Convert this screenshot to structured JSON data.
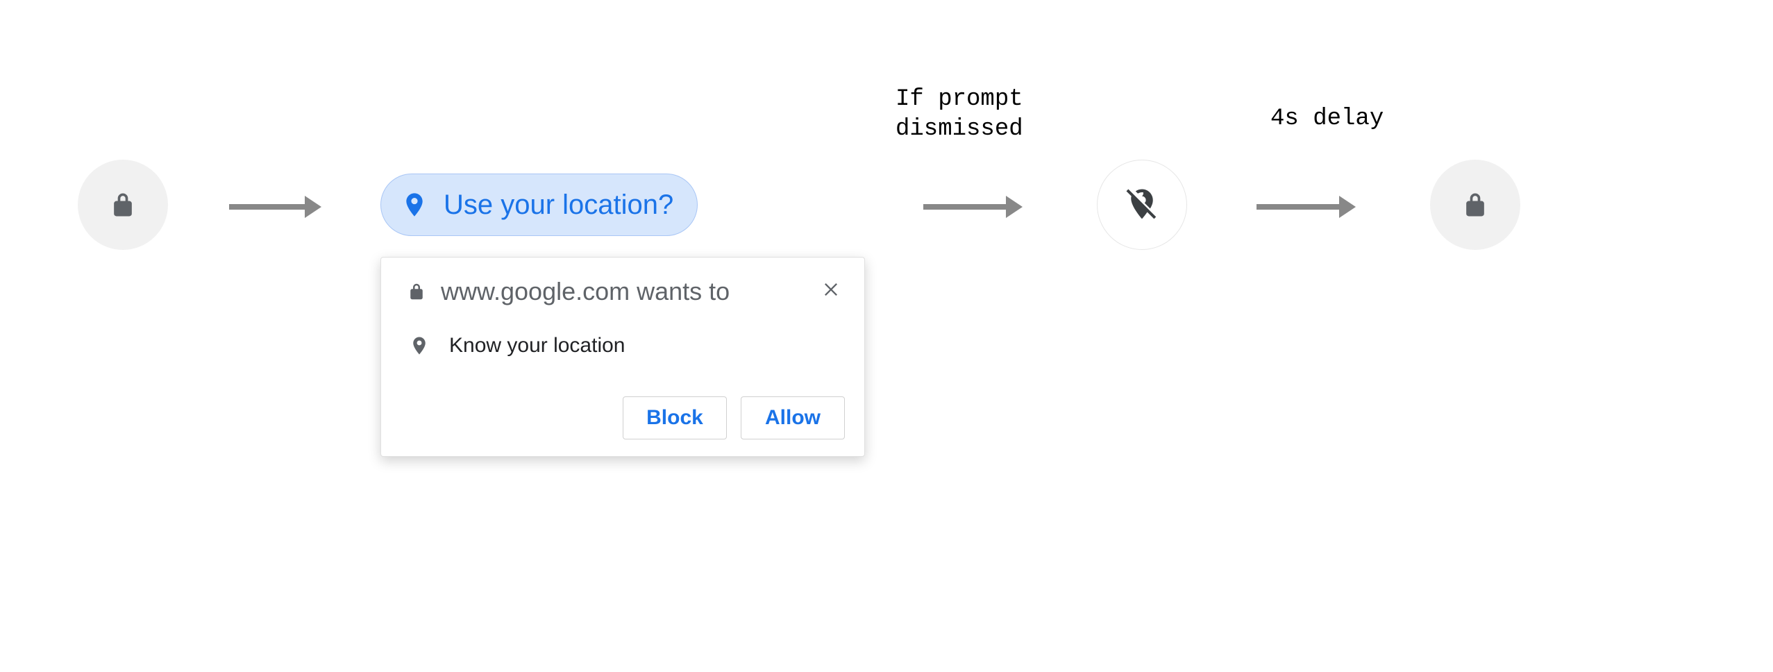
{
  "notes": {
    "dismissed_line1": "If prompt",
    "dismissed_line2": "dismissed",
    "delay": "4s delay"
  },
  "chip": {
    "label": "Use your location?"
  },
  "popup": {
    "wants_to": "www.google.com wants to",
    "permission": "Know your location",
    "block": "Block",
    "allow": "Allow"
  },
  "colors": {
    "blue": "#1a73e8",
    "chip_bg": "#d6e6fc",
    "chip_border": "#a9c6f5",
    "grey_circle": "#f1f1f1",
    "arrow": "#888888",
    "text_muted": "#5f6368"
  }
}
